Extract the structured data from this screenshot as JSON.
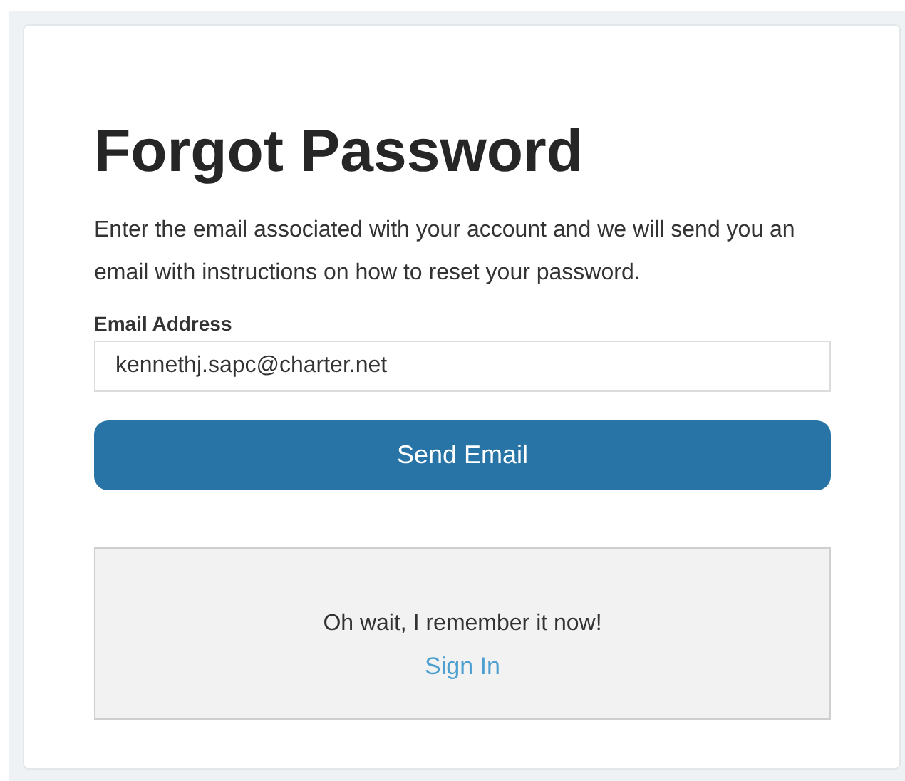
{
  "title": "Forgot Password",
  "instructions": "Enter the email associated with your account and we will send you an email with instructions on how to reset your password.",
  "email_field": {
    "label": "Email Address",
    "value": "kennethj.sapc@charter.net"
  },
  "submit_button": {
    "label": "Send Email"
  },
  "reminder_box": {
    "text": "Oh wait, I remember it now!",
    "link": "Sign In"
  }
}
